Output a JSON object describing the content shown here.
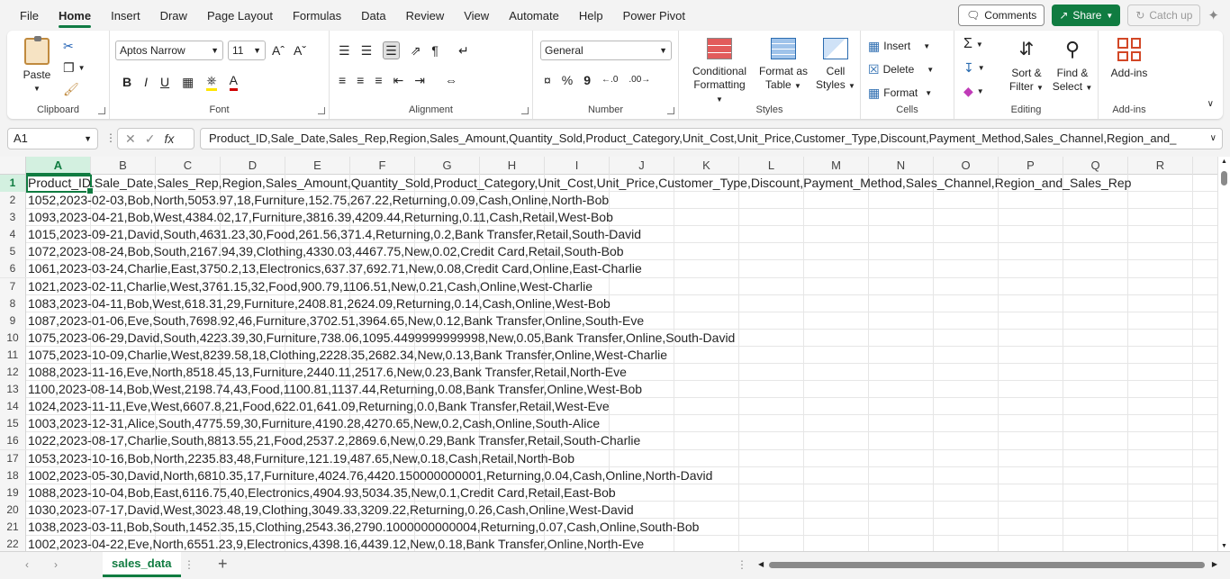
{
  "menu": [
    "File",
    "Home",
    "Insert",
    "Draw",
    "Page Layout",
    "Formulas",
    "Data",
    "Review",
    "View",
    "Automate",
    "Help",
    "Power Pivot"
  ],
  "active_menu": "Home",
  "top_buttons": {
    "comments": "Comments",
    "share": "Share",
    "catchup": "Catch up"
  },
  "ribbon": {
    "clipboard": {
      "label": "Clipboard",
      "paste": "Paste"
    },
    "font": {
      "label": "Font",
      "family": "Aptos Narrow",
      "size": "11",
      "bold": "B",
      "italic": "I",
      "underline": "U"
    },
    "alignment": {
      "label": "Alignment"
    },
    "number": {
      "label": "Number",
      "format": "General",
      "percent": "%",
      "comma": "9"
    },
    "styles": {
      "label": "Styles",
      "conditional_l1": "Conditional",
      "conditional_l2": "Formatting",
      "format_table_l1": "Format as",
      "format_table_l2": "Table",
      "cell_styles_l1": "Cell",
      "cell_styles_l2": "Styles"
    },
    "cells": {
      "label": "Cells",
      "insert": "Insert",
      "delete": "Delete",
      "format": "Format"
    },
    "editing": {
      "label": "Editing",
      "sort_l1": "Sort &",
      "sort_l2": "Filter",
      "find_l1": "Find &",
      "find_l2": "Select"
    },
    "addins": {
      "label": "Add-ins",
      "btn": "Add-ins"
    }
  },
  "formula_bar": {
    "name_box": "A1",
    "fx": "fx",
    "content": "Product_ID,Sale_Date,Sales_Rep,Region,Sales_Amount,Quantity_Sold,Product_Category,Unit_Cost,Unit_Price,Customer_Type,Discount,Payment_Method,Sales_Channel,Region_and_"
  },
  "columns": [
    "A",
    "B",
    "C",
    "D",
    "E",
    "F",
    "G",
    "H",
    "I",
    "J",
    "K",
    "L",
    "M",
    "N",
    "O",
    "P",
    "Q",
    "R"
  ],
  "rows": [
    {
      "n": "1",
      "text": "Product_ID,Sale_Date,Sales_Rep,Region,Sales_Amount,Quantity_Sold,Product_Category,Unit_Cost,Unit_Price,Customer_Type,Discount,Payment_Method,Sales_Channel,Region_and_Sales_Rep"
    },
    {
      "n": "2",
      "text": "1052,2023-02-03,Bob,North,5053.97,18,Furniture,152.75,267.22,Returning,0.09,Cash,Online,North-Bob"
    },
    {
      "n": "3",
      "text": "1093,2023-04-21,Bob,West,4384.02,17,Furniture,3816.39,4209.44,Returning,0.11,Cash,Retail,West-Bob"
    },
    {
      "n": "4",
      "text": "1015,2023-09-21,David,South,4631.23,30,Food,261.56,371.4,Returning,0.2,Bank Transfer,Retail,South-David"
    },
    {
      "n": "5",
      "text": "1072,2023-08-24,Bob,South,2167.94,39,Clothing,4330.03,4467.75,New,0.02,Credit Card,Retail,South-Bob"
    },
    {
      "n": "6",
      "text": "1061,2023-03-24,Charlie,East,3750.2,13,Electronics,637.37,692.71,New,0.08,Credit Card,Online,East-Charlie"
    },
    {
      "n": "7",
      "text": "1021,2023-02-11,Charlie,West,3761.15,32,Food,900.79,1106.51,New,0.21,Cash,Online,West-Charlie"
    },
    {
      "n": "8",
      "text": "1083,2023-04-11,Bob,West,618.31,29,Furniture,2408.81,2624.09,Returning,0.14,Cash,Online,West-Bob"
    },
    {
      "n": "9",
      "text": "1087,2023-01-06,Eve,South,7698.92,46,Furniture,3702.51,3964.65,New,0.12,Bank Transfer,Online,South-Eve"
    },
    {
      "n": "10",
      "text": "1075,2023-06-29,David,South,4223.39,30,Furniture,738.06,1095.4499999999998,New,0.05,Bank Transfer,Online,South-David"
    },
    {
      "n": "11",
      "text": "1075,2023-10-09,Charlie,West,8239.58,18,Clothing,2228.35,2682.34,New,0.13,Bank Transfer,Online,West-Charlie"
    },
    {
      "n": "12",
      "text": "1088,2023-11-16,Eve,North,8518.45,13,Furniture,2440.11,2517.6,New,0.23,Bank Transfer,Retail,North-Eve"
    },
    {
      "n": "13",
      "text": "1100,2023-08-14,Bob,West,2198.74,43,Food,1100.81,1137.44,Returning,0.08,Bank Transfer,Online,West-Bob"
    },
    {
      "n": "14",
      "text": "1024,2023-11-11,Eve,West,6607.8,21,Food,622.01,641.09,Returning,0.0,Bank Transfer,Retail,West-Eve"
    },
    {
      "n": "15",
      "text": "1003,2023-12-31,Alice,South,4775.59,30,Furniture,4190.28,4270.65,New,0.2,Cash,Online,South-Alice"
    },
    {
      "n": "16",
      "text": "1022,2023-08-17,Charlie,South,8813.55,21,Food,2537.2,2869.6,New,0.29,Bank Transfer,Retail,South-Charlie"
    },
    {
      "n": "17",
      "text": "1053,2023-10-16,Bob,North,2235.83,48,Furniture,121.19,487.65,New,0.18,Cash,Retail,North-Bob"
    },
    {
      "n": "18",
      "text": "1002,2023-05-30,David,North,6810.35,17,Furniture,4024.76,4420.150000000001,Returning,0.04,Cash,Online,North-David"
    },
    {
      "n": "19",
      "text": "1088,2023-10-04,Bob,East,6116.75,40,Electronics,4904.93,5034.35,New,0.1,Credit Card,Retail,East-Bob"
    },
    {
      "n": "20",
      "text": "1030,2023-07-17,David,West,3023.48,19,Clothing,3049.33,3209.22,Returning,0.26,Cash,Online,West-David"
    },
    {
      "n": "21",
      "text": "1038,2023-03-11,Bob,South,1452.35,15,Clothing,2543.36,2790.1000000000004,Returning,0.07,Cash,Online,South-Bob"
    },
    {
      "n": "22",
      "text": "1002,2023-04-22,Eve,North,6551.23,9,Electronics,4398.16,4439.12,New,0.18,Bank Transfer,Online,North-Eve"
    }
  ],
  "sheet_tab": "sales_data",
  "colors": {
    "accent": "#107c41"
  }
}
